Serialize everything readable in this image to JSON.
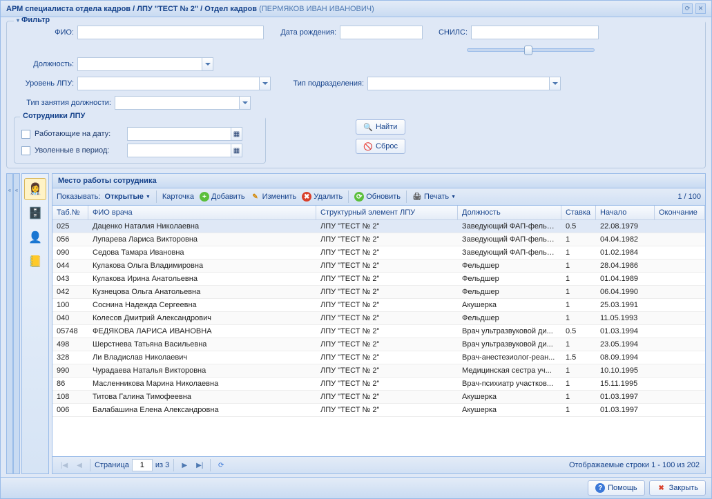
{
  "window": {
    "title_prefix": "АРМ специалиста отдела кадров / ЛПУ \"ТЕСТ № 2\" / Отдел кадров",
    "user": "(ПЕРМЯКОВ ИВАН ИВАНОВИЧ)"
  },
  "filter": {
    "legend": "Фильтр",
    "fio_label": "ФИО:",
    "birthdate_label": "Дата рождения:",
    "snils_label": "СНИЛС:",
    "position_label": "Должность:",
    "lpu_level_label": "Уровень ЛПУ:",
    "division_type_label": "Тип подразделения:",
    "employment_type_label": "Тип занятия должности:",
    "lpu_staff_legend": "Сотрудники ЛПУ",
    "working_on_date_label": "Работающие на дату:",
    "fired_in_period_label": "Уволенные в период:",
    "find_btn": "Найти",
    "reset_btn": "Сброс"
  },
  "grid": {
    "title": "Место работы сотрудника",
    "toolbar": {
      "show_label": "Показывать:",
      "show_value": "Открытые",
      "card": "Карточка",
      "add": "Добавить",
      "edit": "Изменить",
      "delete": "Удалить",
      "refresh": "Обновить",
      "print": "Печать",
      "count": "1 / 100"
    },
    "columns": {
      "tab": "Таб.№",
      "name": "ФИО врача",
      "lpu": "Структурный элемент ЛПУ",
      "position": "Должность",
      "rate": "Ставка",
      "start": "Начало",
      "end": "Окончание"
    },
    "rows": [
      {
        "tab": "025",
        "name": "Даценко Наталия Николаевна",
        "lpu": "ЛПУ \"ТЕСТ № 2\"",
        "pos": "Заведующий ФАП-фельд...",
        "rate": "0.5",
        "start": "22.08.1979",
        "end": ""
      },
      {
        "tab": "056",
        "name": "Лупарева Лариса Викторовна",
        "lpu": "ЛПУ \"ТЕСТ № 2\"",
        "pos": "Заведующий ФАП-фельд...",
        "rate": "1",
        "start": "04.04.1982",
        "end": ""
      },
      {
        "tab": "090",
        "name": "Седова Тамара Ивановна",
        "lpu": "ЛПУ \"ТЕСТ № 2\"",
        "pos": "Заведующий ФАП-фельд...",
        "rate": "1",
        "start": "01.02.1984",
        "end": ""
      },
      {
        "tab": "044",
        "name": "Кулакова Ольга Владимировна",
        "lpu": "ЛПУ \"ТЕСТ № 2\"",
        "pos": "Фельдшер",
        "rate": "1",
        "start": "28.04.1986",
        "end": ""
      },
      {
        "tab": "043",
        "name": "Кулакова Ирина Анатольевна",
        "lpu": "ЛПУ \"ТЕСТ № 2\"",
        "pos": "Фельдшер",
        "rate": "1",
        "start": "01.04.1989",
        "end": ""
      },
      {
        "tab": "042",
        "name": "Кузнецова Ольга Анатольевна",
        "lpu": "ЛПУ \"ТЕСТ № 2\"",
        "pos": "Фельдшер",
        "rate": "1",
        "start": "06.04.1990",
        "end": ""
      },
      {
        "tab": "100",
        "name": "Соснина Надежда Сергеевна",
        "lpu": "ЛПУ \"ТЕСТ № 2\"",
        "pos": "Акушерка",
        "rate": "1",
        "start": "25.03.1991",
        "end": ""
      },
      {
        "tab": "040",
        "name": "Колесов Дмитрий Александрович",
        "lpu": "ЛПУ \"ТЕСТ № 2\"",
        "pos": "Фельдшер",
        "rate": "1",
        "start": "11.05.1993",
        "end": ""
      },
      {
        "tab": "05748",
        "name": "ФЕДЯКОВА ЛАРИСА ИВАНОВНА",
        "lpu": "ЛПУ \"ТЕСТ № 2\"",
        "pos": "Врач ультразвуковой ди...",
        "rate": "0.5",
        "start": "01.03.1994",
        "end": ""
      },
      {
        "tab": "498",
        "name": "Шерстнева Татьяна Васильевна",
        "lpu": "ЛПУ \"ТЕСТ № 2\"",
        "pos": "Врач ультразвуковой ди...",
        "rate": "1",
        "start": "23.05.1994",
        "end": ""
      },
      {
        "tab": "328",
        "name": "Ли Владислав Николаевич",
        "lpu": "ЛПУ \"ТЕСТ № 2\"",
        "pos": "Врач-анестезиолог-реан...",
        "rate": "1.5",
        "start": "08.09.1994",
        "end": ""
      },
      {
        "tab": "990",
        "name": "Чурадаева Наталья Викторовна",
        "lpu": "ЛПУ \"ТЕСТ № 2\"",
        "pos": "Медицинская сестра уч...",
        "rate": "1",
        "start": "10.10.1995",
        "end": ""
      },
      {
        "tab": "86",
        "name": "Масленникова Марина Николаевна",
        "lpu": "ЛПУ \"ТЕСТ № 2\"",
        "pos": "Врач-психиатр участков...",
        "rate": "1",
        "start": "15.11.1995",
        "end": ""
      },
      {
        "tab": "108",
        "name": "Титова Галина Тимофеевна",
        "lpu": "ЛПУ \"ТЕСТ № 2\"",
        "pos": "Акушерка",
        "rate": "1",
        "start": "01.03.1997",
        "end": ""
      },
      {
        "tab": "006",
        "name": "Балабашина Елена Александровна",
        "lpu": "ЛПУ \"ТЕСТ № 2\"",
        "pos": "Акушерка",
        "rate": "1",
        "start": "01.03.1997",
        "end": ""
      }
    ],
    "pager": {
      "page_label": "Страница",
      "page": "1",
      "of_label": "из 3",
      "info": "Отображаемые строки 1 - 100 из 202"
    }
  },
  "footer": {
    "help": "Помощь",
    "close": "Закрыть"
  }
}
